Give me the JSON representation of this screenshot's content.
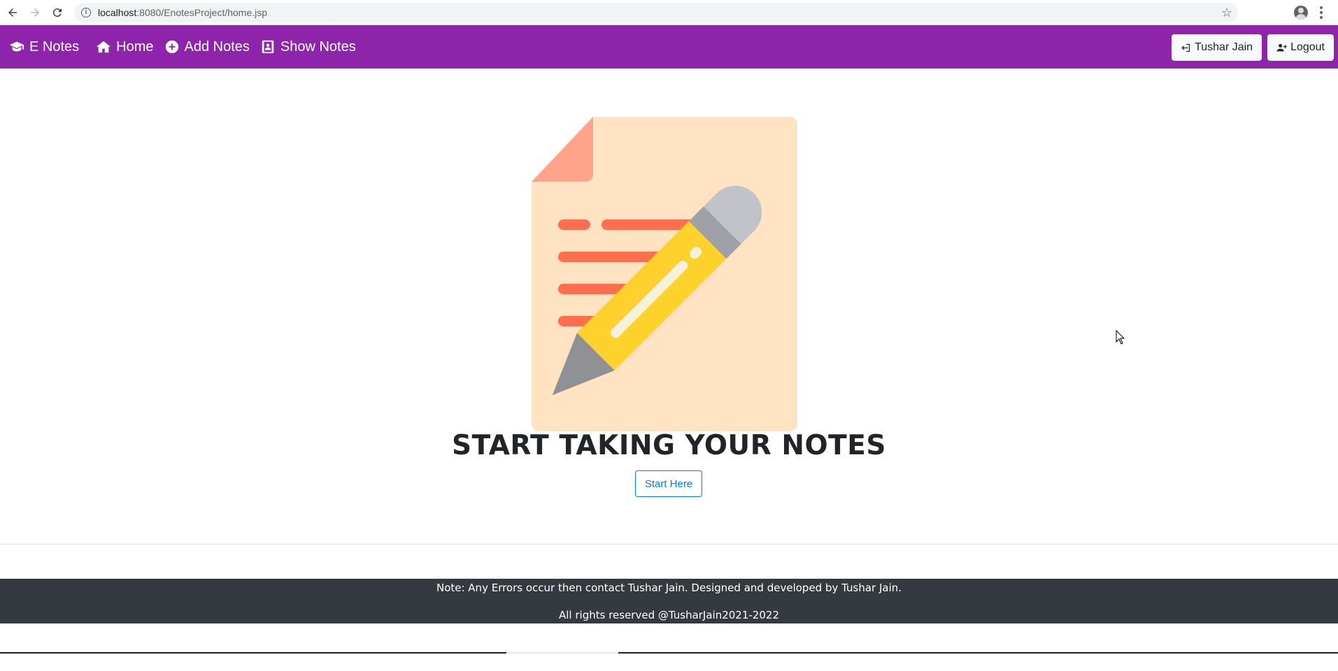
{
  "browser": {
    "url_host": "localhost",
    "url_path": ":8080/EnotesProject/home.jsp",
    "icons": [
      "back-arrow-icon",
      "forward-arrow-icon",
      "reload-icon",
      "info-icon",
      "star-icon",
      "profile-icon",
      "kebab-menu-icon"
    ]
  },
  "navbar": {
    "brand": "E Notes",
    "links": [
      {
        "label": "Home",
        "icon": "home-icon"
      },
      {
        "label": "Add Notes",
        "icon": "plus-circle-icon"
      },
      {
        "label": "Show Notes",
        "icon": "address-book-icon"
      }
    ],
    "user_label": "Tushar Jain",
    "logout_label": "Logout",
    "background": "#8e24aa"
  },
  "hero": {
    "title": "START TAKING YOUR NOTES",
    "button_label": "Start Here"
  },
  "footer": {
    "line1": "Note: Any Errors occur then contact Tushar Jain. Designed and developed by Tushar Jain.",
    "line2": "All rights reserved @TusharJain2021-2022",
    "background": "#343a40"
  },
  "colors": {
    "accent": "#8e24aa",
    "primary": "#007bff",
    "footer": "#343a40"
  }
}
